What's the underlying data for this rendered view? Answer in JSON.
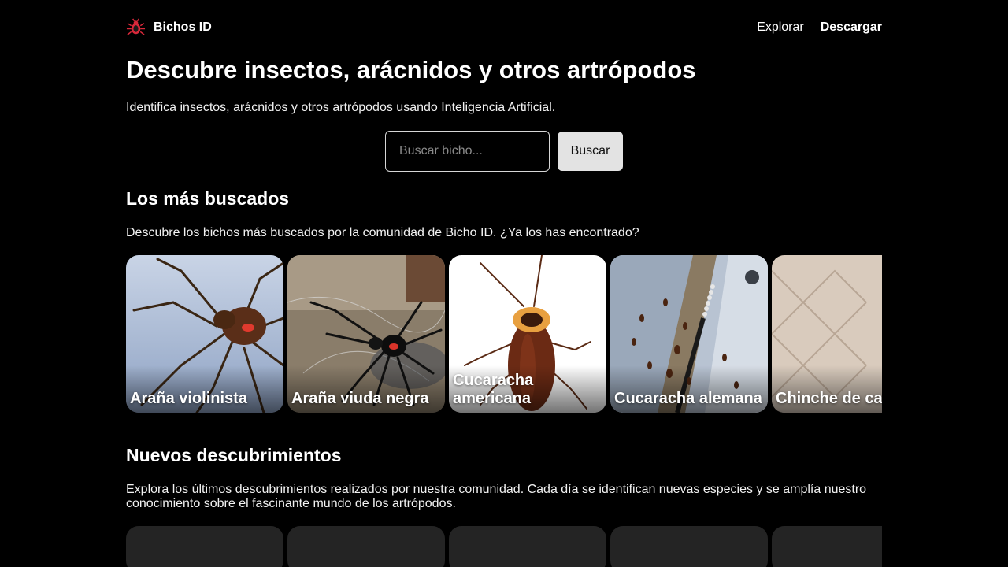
{
  "header": {
    "brand": "Bichos ID",
    "nav": {
      "explore": "Explorar",
      "download": "Descargar"
    }
  },
  "hero": {
    "title": "Descubre insectos, arácnidos y otros artrópodos",
    "subtitle": "Identifica insectos, arácnidos y otros artrópodos usando Inteligencia Artificial."
  },
  "search": {
    "placeholder": "Buscar bicho...",
    "button": "Buscar"
  },
  "popular": {
    "title": "Los más buscados",
    "description": "Descubre los bichos más buscados por la comunidad de Bicho ID. ¿Ya los has encontrado?",
    "items": [
      {
        "label": "Araña violinista"
      },
      {
        "label": "Araña viuda negra"
      },
      {
        "label": "Cucaracha americana"
      },
      {
        "label": "Cucaracha alemana"
      },
      {
        "label": "Chinche de cama"
      }
    ]
  },
  "discoveries": {
    "title": "Nuevos descubrimientos",
    "description": "Explora los últimos descubrimientos realizados por nuestra comunidad. Cada día se identifican nuevas especies y se amplía nuestro conocimiento sobre el fascinante mundo de los artrópodos."
  },
  "colors": {
    "background": "#000000",
    "card_placeholder": "#242424",
    "logo_accent": "#d8283a"
  }
}
